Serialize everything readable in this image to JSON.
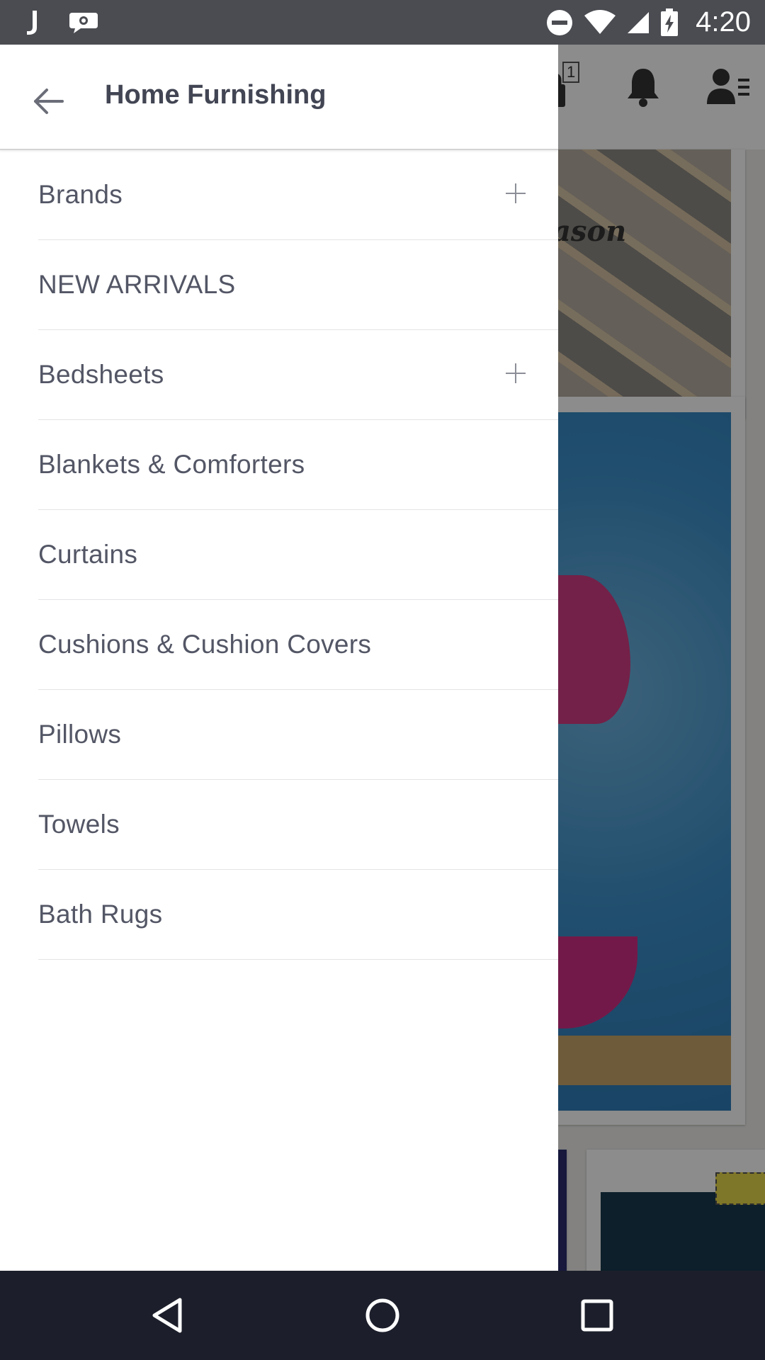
{
  "status_bar": {
    "time": "4:20",
    "left_icons": [
      "jiomart-j-icon",
      "chat-bubble-icon"
    ],
    "right_icons": [
      "do-not-disturb-icon",
      "wifi-icon",
      "signal-icon",
      "battery-charging-icon"
    ]
  },
  "background_app": {
    "cart_count": "1",
    "card_text": "ason"
  },
  "drawer": {
    "title": "Home Furnishing",
    "items": [
      {
        "label": "Brands",
        "expandable": true
      },
      {
        "label": "NEW ARRIVALS",
        "expandable": false
      },
      {
        "label": "Bedsheets",
        "expandable": true
      },
      {
        "label": "Blankets & Comforters",
        "expandable": false
      },
      {
        "label": "Curtains",
        "expandable": false
      },
      {
        "label": "Cushions & Cushion Covers",
        "expandable": false
      },
      {
        "label": "Pillows",
        "expandable": false
      },
      {
        "label": "Towels",
        "expandable": false
      },
      {
        "label": "Bath Rugs",
        "expandable": false
      }
    ]
  },
  "colors": {
    "status_bar": "#4a4c52",
    "nav_bar": "#1c1f2b",
    "title_text": "#424553",
    "item_text": "#535665",
    "divider": "#e4e4e6"
  }
}
